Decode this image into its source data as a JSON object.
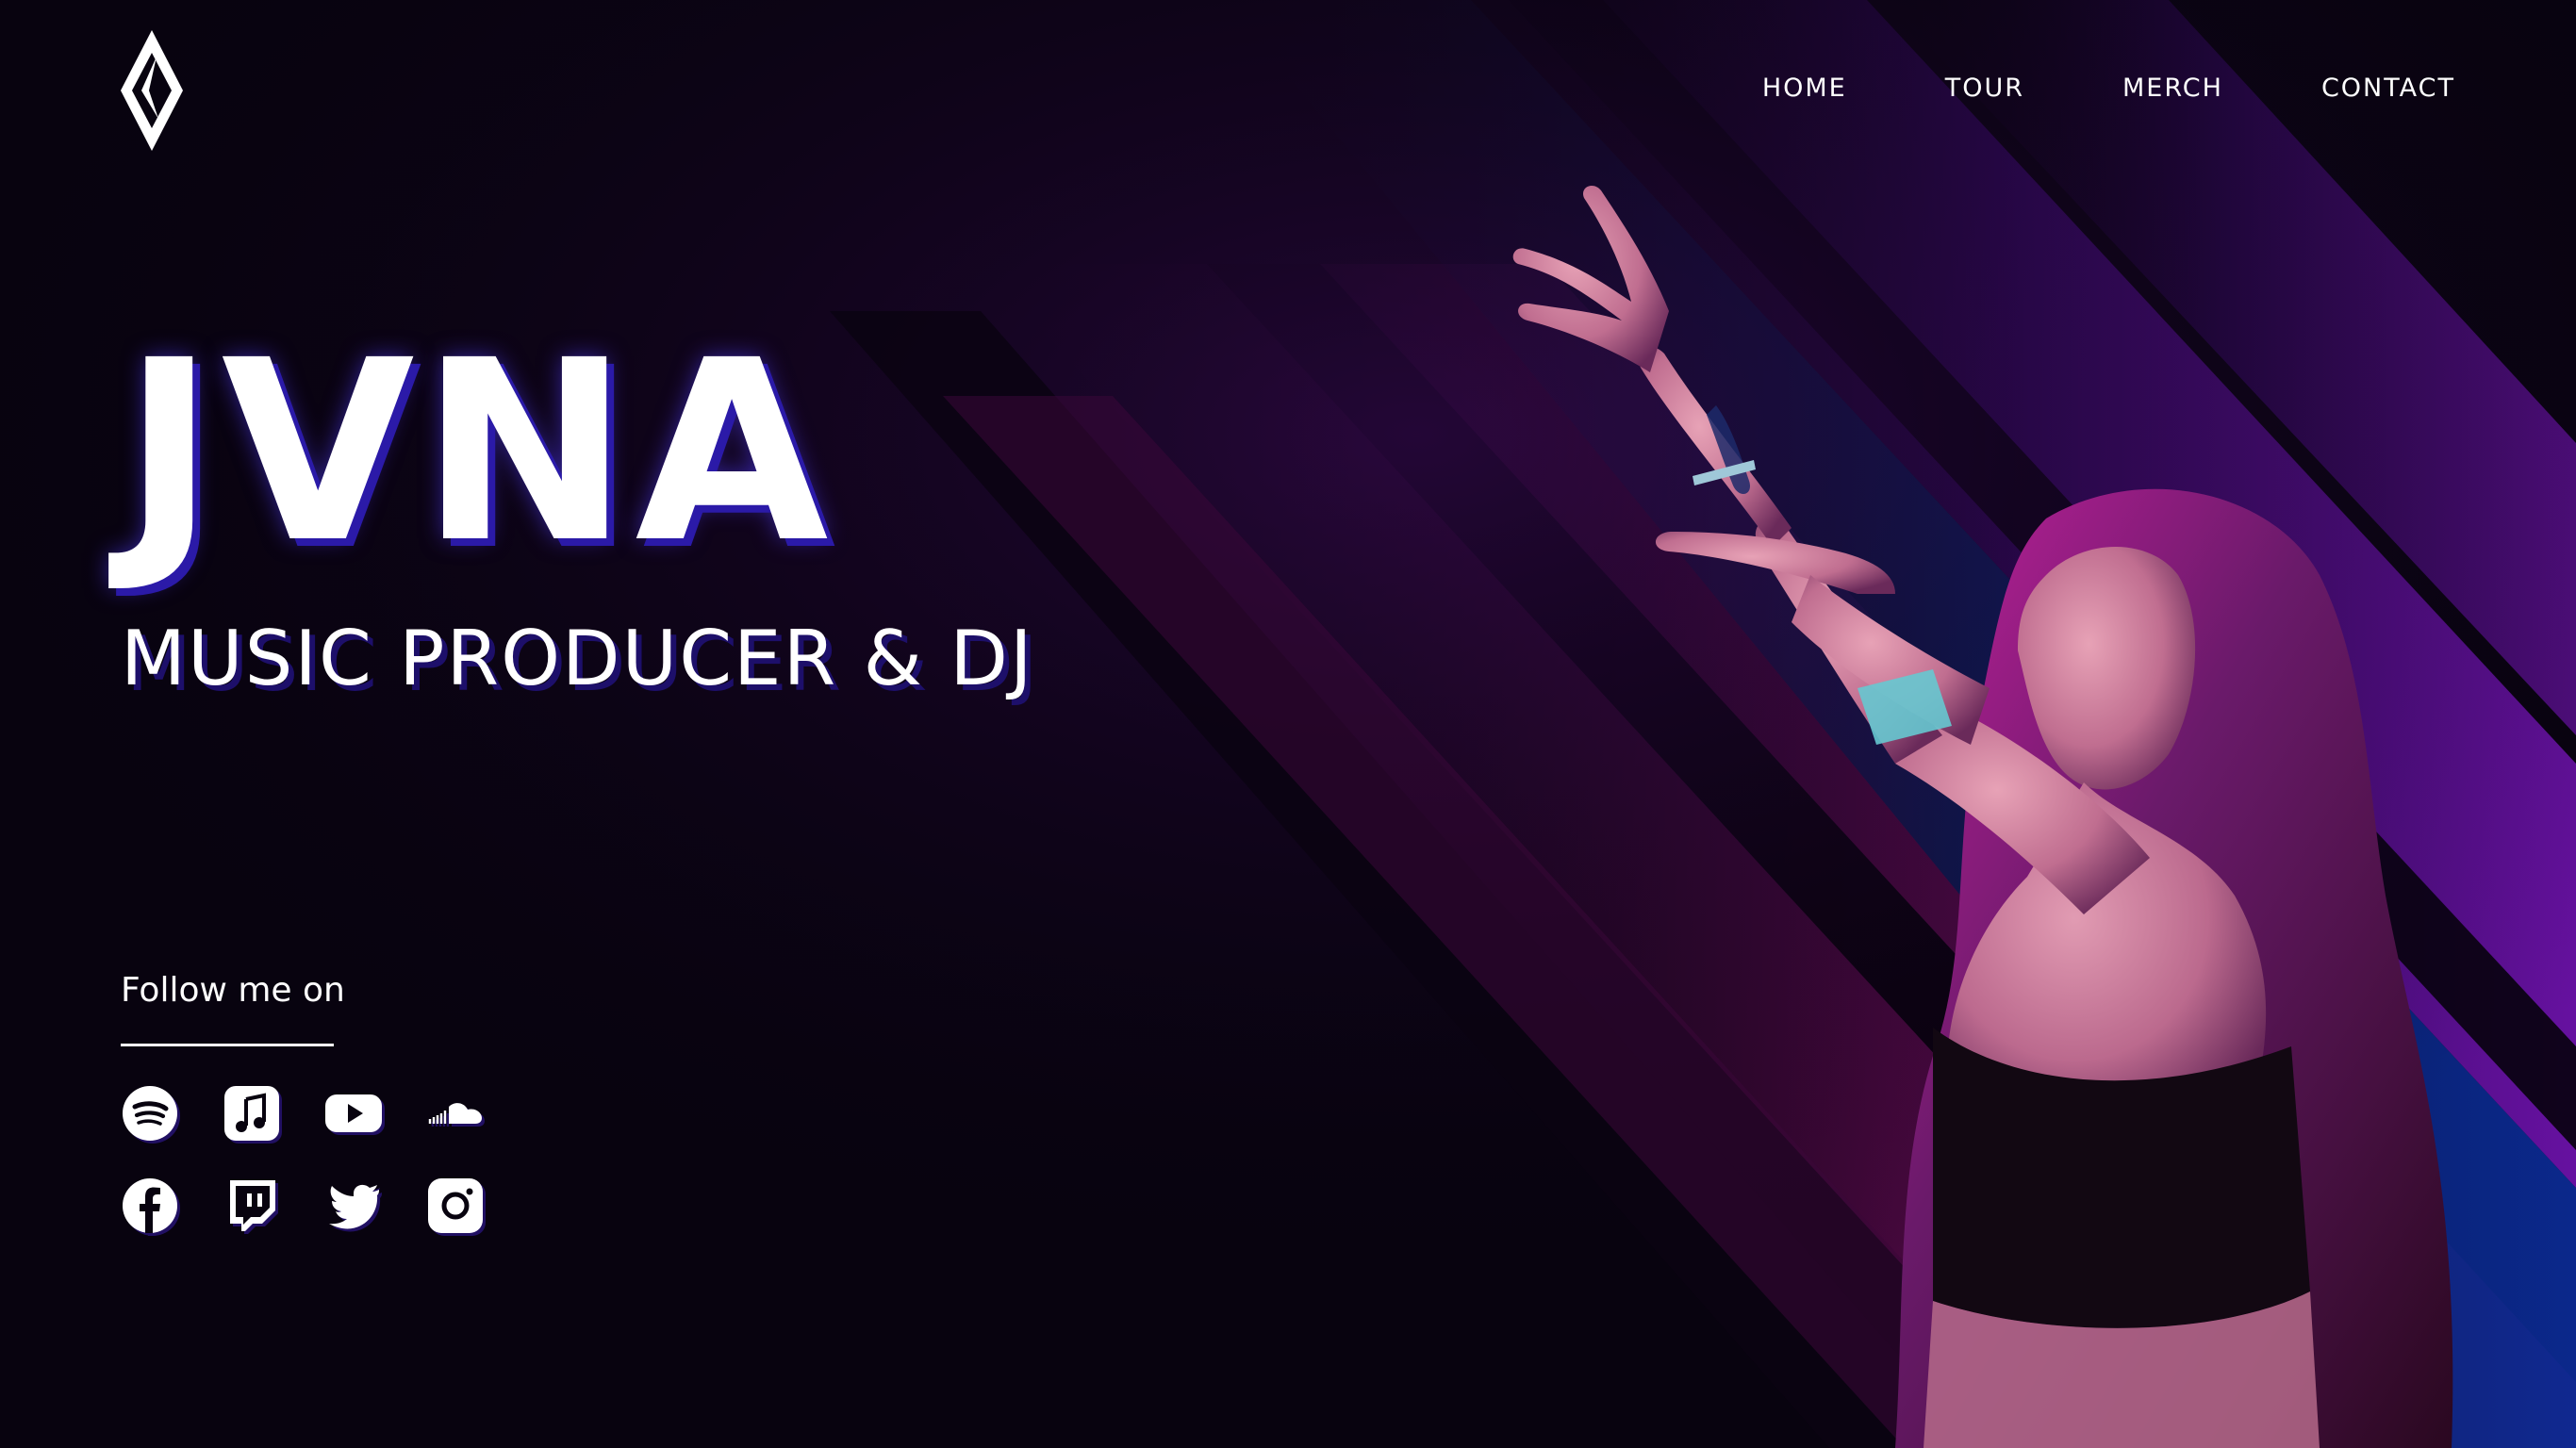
{
  "brand": {
    "name": "JVNA",
    "tagline": "MUSIC PRODUCER & DJ",
    "logo_icon": "diamond-logo-icon"
  },
  "nav": {
    "items": [
      {
        "label": "HOME"
      },
      {
        "label": "TOUR"
      },
      {
        "label": "MERCH"
      },
      {
        "label": "CONTACT"
      }
    ]
  },
  "follow": {
    "label": "Follow me on"
  },
  "socials": {
    "row1": [
      {
        "icon": "spotify-icon"
      },
      {
        "icon": "apple-music-icon"
      },
      {
        "icon": "youtube-icon"
      },
      {
        "icon": "soundcloud-icon"
      }
    ],
    "row2": [
      {
        "icon": "facebook-icon"
      },
      {
        "icon": "twitch-icon"
      },
      {
        "icon": "twitter-icon"
      },
      {
        "icon": "instagram-icon"
      }
    ]
  },
  "colors": {
    "background": "#08030f",
    "accent_magenta": "#8a0f7a",
    "accent_purple": "#5a0fa0",
    "accent_blue": "#0a2a8a",
    "wordmark_shadow": "#2b1aa8"
  }
}
